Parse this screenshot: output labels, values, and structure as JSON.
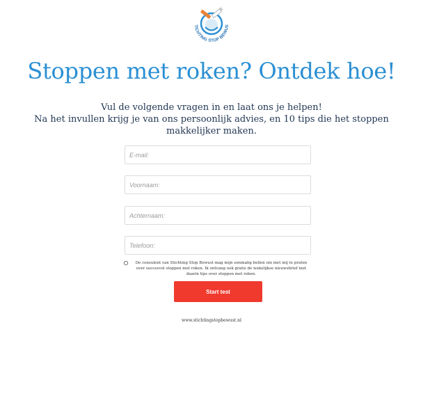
{
  "logo": {
    "text": "STICHTING STOP BEWUST",
    "icon": "no-smoking-logo-icon",
    "colors": {
      "text": "#2e77b8",
      "cigarette": "#e8833a",
      "bowl": "#2a8fd3"
    }
  },
  "hero": {
    "title": "Stoppen met roken? Ontdek hoe!",
    "intro_line_1": "Vul de volgende vragen in en laat ons je helpen!",
    "intro_line_2": "Na het invullen krijg je van ons persoonlijk advies, en 10 tips die het stoppen",
    "intro_line_3": "makkelijker maken."
  },
  "form": {
    "email_placeholder": "E-mail:",
    "voornaam_placeholder": "Voornaam:",
    "achternaam_placeholder": "Achternaam:",
    "telefoon_placeholder": "Telefoon:",
    "consent_text": "De consulent van Stichting Stop Bewust mag mijn eenmalig bellen om met mij te praten over succesvol stoppen met roken. Ik ontvang ook gratis de wekelijkse nieuwsbrief met daarin tips over stoppen met roken.",
    "submit_label": "Start test"
  },
  "footer": {
    "link_text": "www.stichtingstopbewust.nl"
  },
  "colors": {
    "headline": "#2a8fd3",
    "intro_text": "#1f3552",
    "button": "#f03a2e",
    "field_border": "#dcdcdc"
  }
}
